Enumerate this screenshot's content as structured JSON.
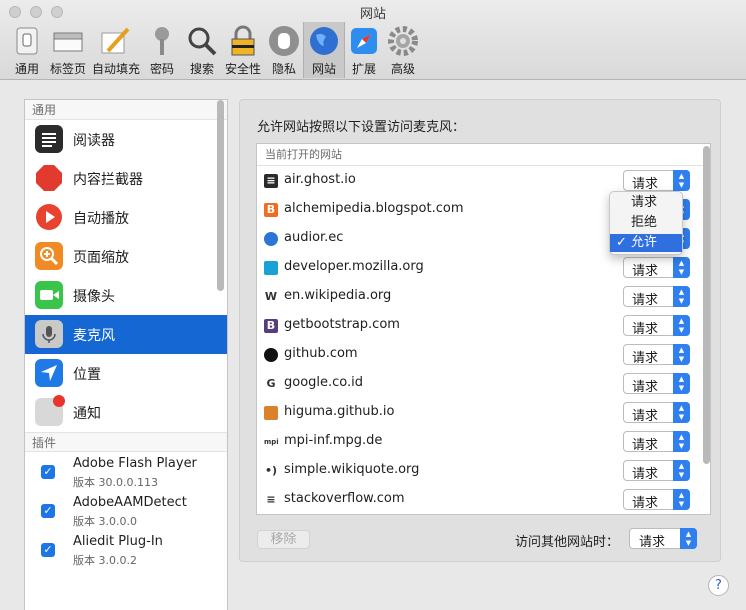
{
  "window": {
    "title": "网站"
  },
  "toolbar": {
    "items": [
      {
        "label": "通用",
        "icon": "switch-icon"
      },
      {
        "label": "标签页",
        "icon": "tabs-icon"
      },
      {
        "label": "自动填充",
        "icon": "pencil-icon"
      },
      {
        "label": "密码",
        "icon": "key-icon"
      },
      {
        "label": "搜索",
        "icon": "magnifier-icon"
      },
      {
        "label": "安全性",
        "icon": "lock-icon"
      },
      {
        "label": "隐私",
        "icon": "hand-icon"
      },
      {
        "label": "网站",
        "icon": "globe-icon",
        "active": true
      },
      {
        "label": "扩展",
        "icon": "compass-icon"
      },
      {
        "label": "高级",
        "icon": "gear-icon"
      }
    ]
  },
  "sidebar": {
    "general_header": "通用",
    "items": [
      {
        "label": "阅读器",
        "icon": "reader-icon",
        "color": "#2b2b2b"
      },
      {
        "label": "内容拦截器",
        "icon": "stop-icon",
        "color": "#e03b2e"
      },
      {
        "label": "自动播放",
        "icon": "play-icon",
        "color": "#e8432f"
      },
      {
        "label": "页面缩放",
        "icon": "zoom-icon",
        "color": "#f08a24"
      },
      {
        "label": "摄像头",
        "icon": "camera-icon",
        "color": "#3bc44a"
      },
      {
        "label": "麦克风",
        "icon": "microphone-icon",
        "color": "#9a9a9a",
        "selected": true
      },
      {
        "label": "位置",
        "icon": "location-icon",
        "color": "#1f7ae8"
      },
      {
        "label": "通知",
        "icon": "notification-icon",
        "color": "#d8d8d8"
      }
    ],
    "plugins_header": "插件",
    "plugins": [
      {
        "name": "Adobe Flash Player",
        "version": "版本 30.0.0.113"
      },
      {
        "name": "AdobeAAMDetect",
        "version": "版本 3.0.0.0"
      },
      {
        "name": "Aliedit Plug-In",
        "version": "版本 3.0.0.2"
      }
    ]
  },
  "panel": {
    "heading": "允许网站按照以下设置访问麦克风：",
    "table_header": "当前打开的网站",
    "rows": [
      {
        "site": "air.ghost.io",
        "value": "请求",
        "icon": "ghost-icon",
        "icon_color": "#2a2a2a",
        "glyph": "≡"
      },
      {
        "site": "alchemipedia.blogspot.com",
        "value": "请求",
        "icon": "blogger-icon",
        "icon_color": "#f26b21",
        "glyph": "B"
      },
      {
        "site": "audior.ec",
        "value": "允许",
        "icon": "globe-icon",
        "icon_color": "#2b75d6",
        "glyph": ""
      },
      {
        "site": "developer.mozilla.org",
        "value": "请求",
        "icon": "dino-icon",
        "icon_color": "#1aa1d6",
        "glyph": ""
      },
      {
        "site": "en.wikipedia.org",
        "value": "请求",
        "icon": "wikipedia-icon",
        "icon_color": "#ffffff",
        "glyph": "W"
      },
      {
        "site": "getbootstrap.com",
        "value": "请求",
        "icon": "bootstrap-icon",
        "icon_color": "#563d7c",
        "glyph": "B"
      },
      {
        "site": "github.com",
        "value": "请求",
        "icon": "github-icon",
        "icon_color": "#111111",
        "glyph": ""
      },
      {
        "site": "google.co.id",
        "value": "请求",
        "icon": "google-icon",
        "icon_color": "#ffffff",
        "glyph": "G"
      },
      {
        "site": "higuma.github.io",
        "value": "请求",
        "icon": "bear-icon",
        "icon_color": "#d9822b",
        "glyph": ""
      },
      {
        "site": "mpi-inf.mpg.de",
        "value": "请求",
        "icon": "mpi-icon",
        "icon_color": "#ffffff",
        "glyph": "mpi"
      },
      {
        "site": "simple.wikiquote.org",
        "value": "请求",
        "icon": "wikiquote-icon",
        "icon_color": "#ffffff",
        "glyph": "•)"
      },
      {
        "site": "stackoverflow.com",
        "value": "请求",
        "icon": "stackoverflow-icon",
        "icon_color": "#ffffff",
        "glyph": "≡"
      }
    ],
    "dropdown_menu": {
      "options": [
        "请求",
        "拒绝",
        "允许"
      ],
      "checked": "允许",
      "check_mark": "✓"
    },
    "remove_button": "移除",
    "other_sites_label": "访问其他网站时：",
    "other_sites_value": "请求",
    "help": "?"
  },
  "colors": {
    "accent": "#1567d3",
    "popup_arrow": "#2f7ff0"
  }
}
